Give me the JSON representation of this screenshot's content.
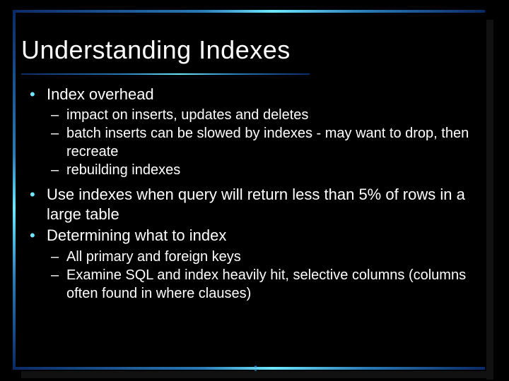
{
  "title": "Understanding Indexes",
  "bullets": {
    "b1": {
      "text": "Index overhead",
      "sub": [
        "impact on inserts, updates and deletes",
        "batch inserts can be slowed by indexes - may want to drop, then recreate",
        "rebuilding indexes"
      ]
    },
    "b2": {
      "text": "Use indexes when query will return less than 5% of rows in a large table"
    },
    "b3": {
      "text": "Determining what to index",
      "sub": [
        "All primary and foreign keys",
        "Examine SQL and index heavily hit, selective columns (columns often found in where clauses)"
      ]
    }
  }
}
